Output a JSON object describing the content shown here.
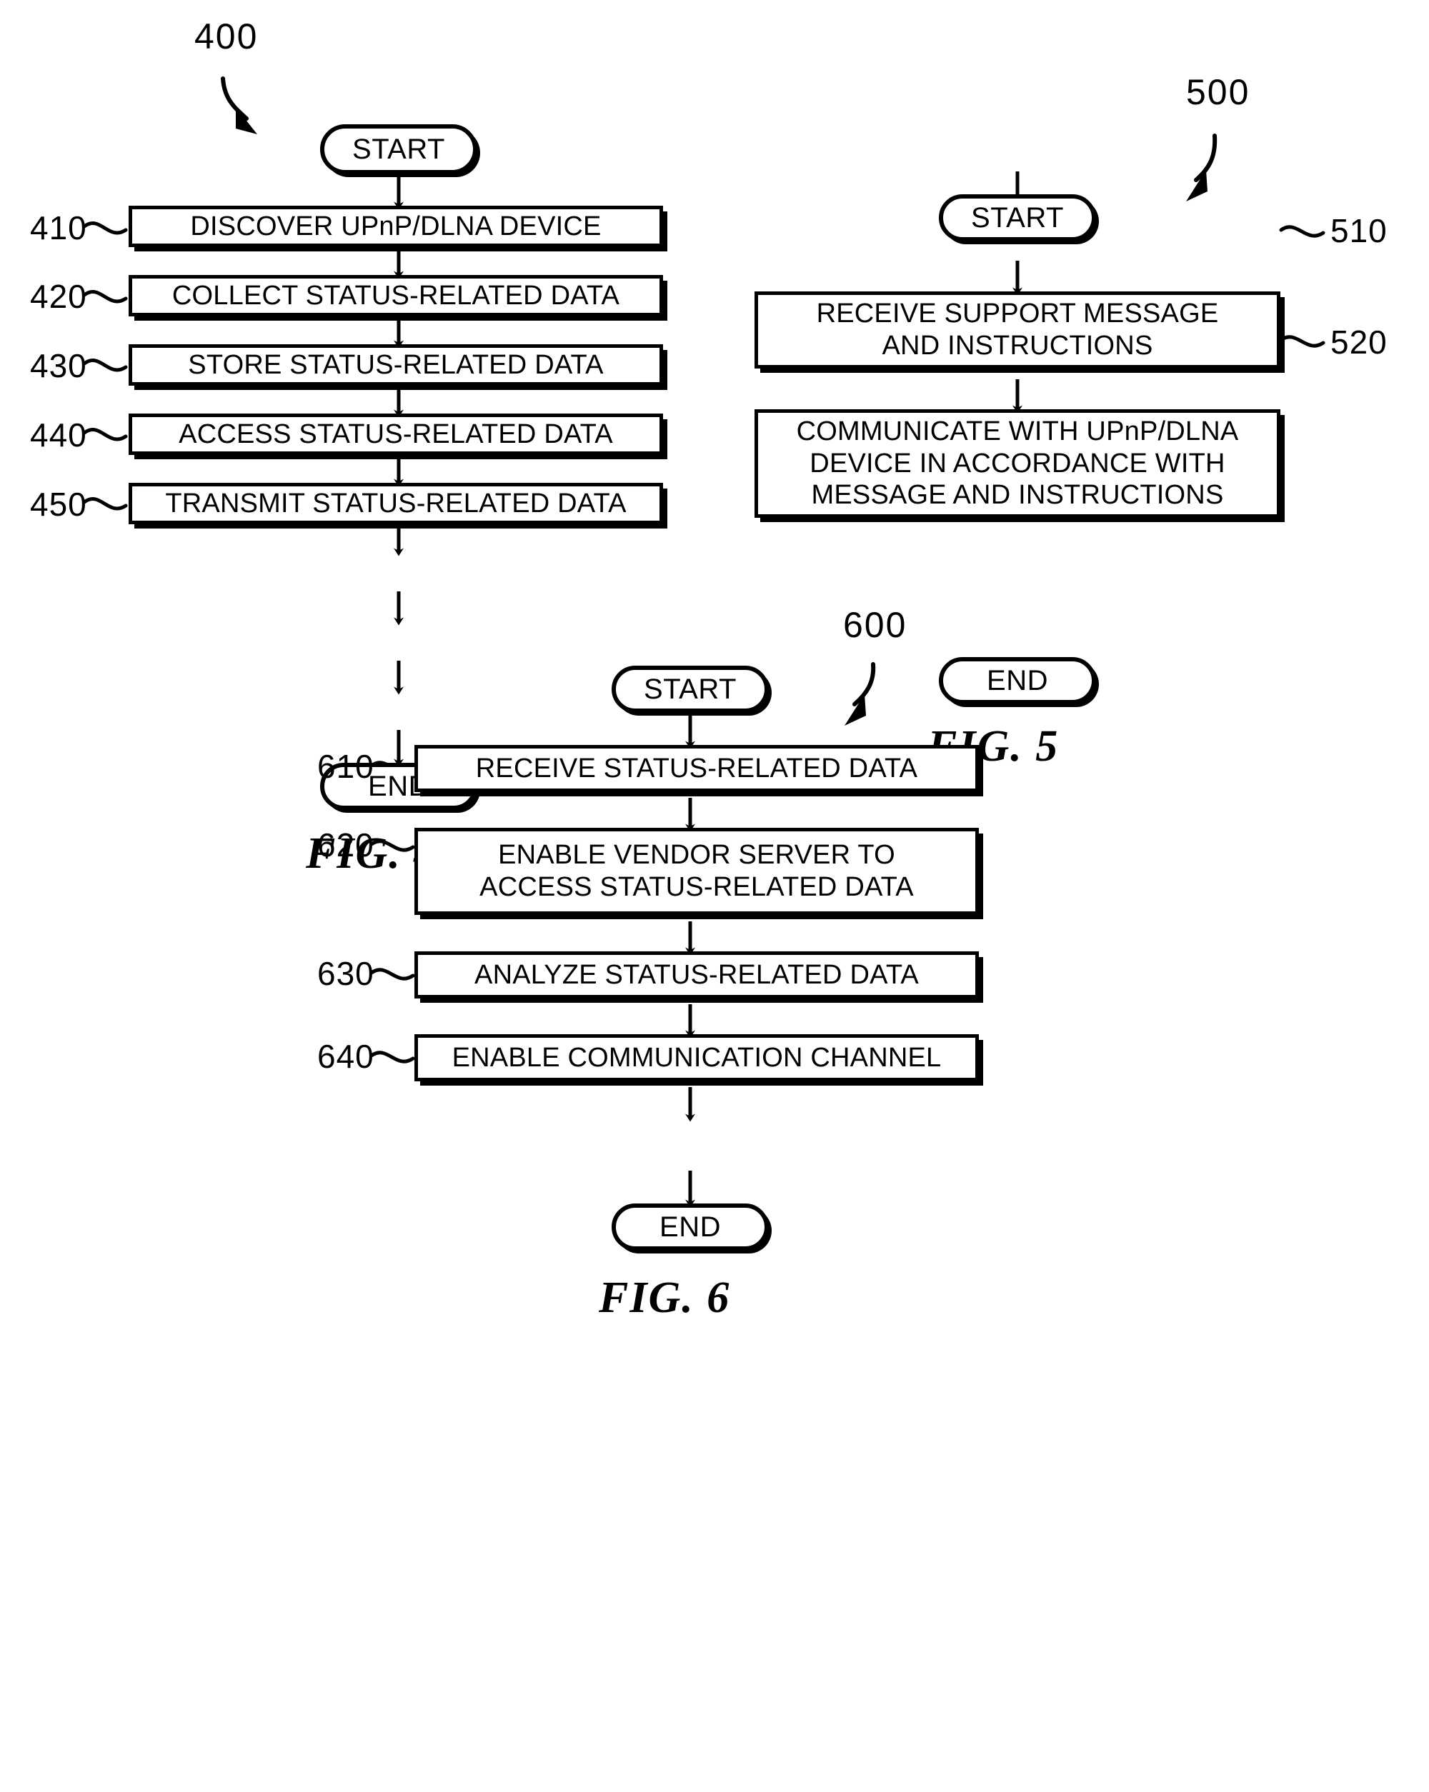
{
  "figures": [
    {
      "id": "fig4",
      "flow_number": "400",
      "caption": "FIG. 4",
      "start_label": "START",
      "end_label": "END",
      "steps": [
        {
          "ref": "410",
          "text": "DISCOVER UPnP/DLNA DEVICE"
        },
        {
          "ref": "420",
          "text": "COLLECT STATUS-RELATED DATA"
        },
        {
          "ref": "430",
          "text": "STORE STATUS-RELATED DATA"
        },
        {
          "ref": "440",
          "text": "ACCESS STATUS-RELATED DATA"
        },
        {
          "ref": "450",
          "text": "TRANSMIT STATUS-RELATED DATA"
        }
      ]
    },
    {
      "id": "fig5",
      "flow_number": "500",
      "caption": "FIG. 5",
      "start_label": "START",
      "end_label": "END",
      "steps": [
        {
          "ref": "510",
          "text": "RECEIVE SUPPORT MESSAGE\nAND INSTRUCTIONS"
        },
        {
          "ref": "520",
          "text": "COMMUNICATE WITH UPnP/DLNA\nDEVICE IN ACCORDANCE WITH\nMESSAGE AND INSTRUCTIONS"
        }
      ]
    },
    {
      "id": "fig6",
      "flow_number": "600",
      "caption": "FIG. 6",
      "start_label": "START",
      "end_label": "END",
      "steps": [
        {
          "ref": "610",
          "text": "RECEIVE STATUS-RELATED DATA"
        },
        {
          "ref": "620",
          "text": "ENABLE VENDOR SERVER TO\nACCESS STATUS-RELATED DATA"
        },
        {
          "ref": "630",
          "text": "ANALYZE STATUS-RELATED DATA"
        },
        {
          "ref": "640",
          "text": "ENABLE COMMUNICATION CHANNEL"
        }
      ]
    }
  ],
  "colors": {
    "ink": "#000000",
    "paper": "#ffffff"
  }
}
